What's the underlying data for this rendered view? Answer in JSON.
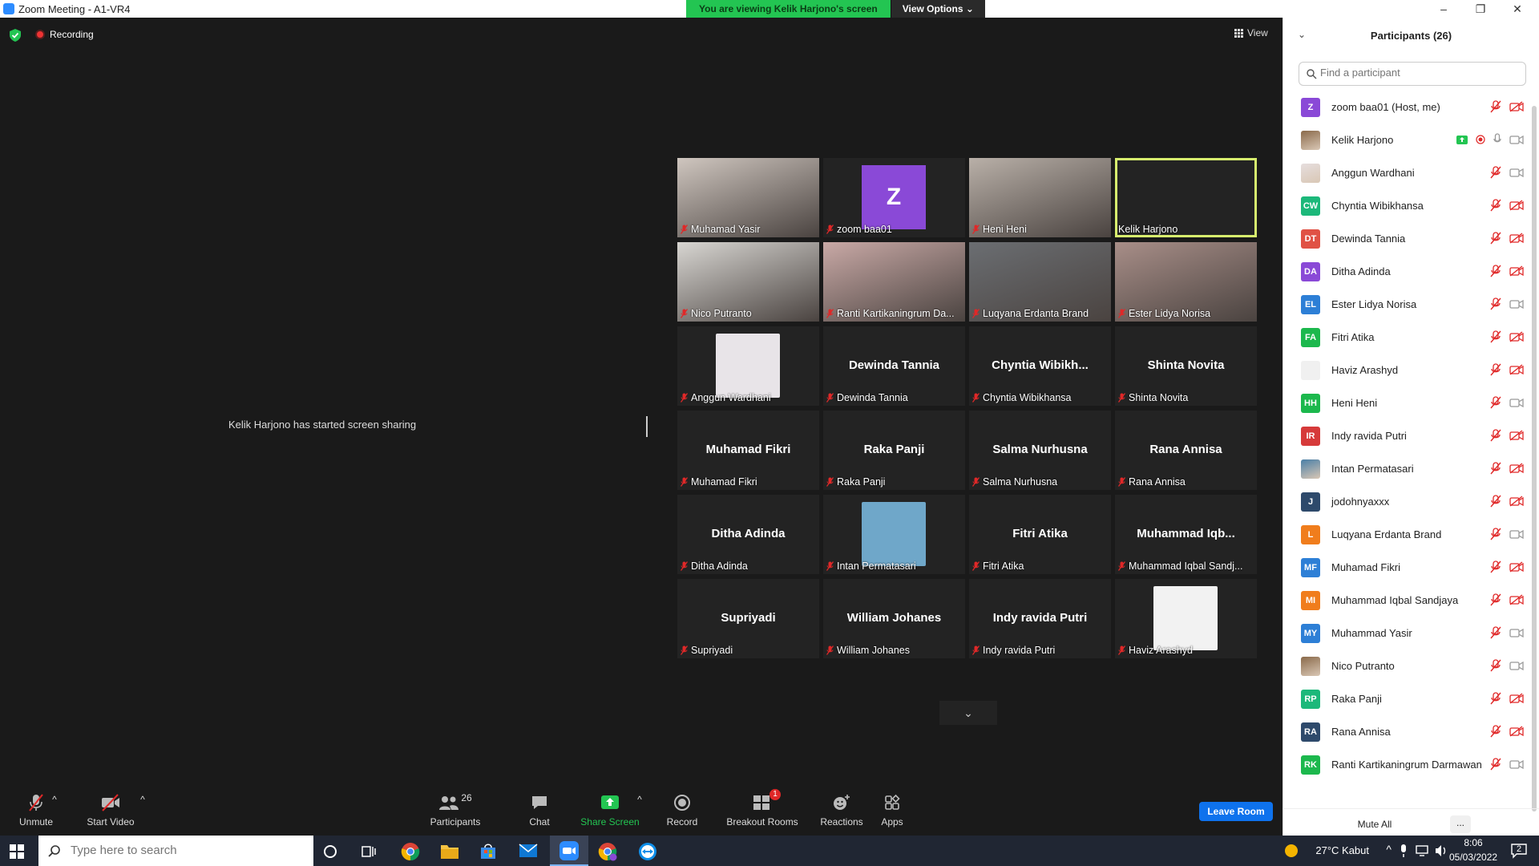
{
  "window": {
    "title": "Zoom Meeting - A1-VR4"
  },
  "share_banner": {
    "text": "You are viewing Kelik Harjono's screen",
    "view_options": "View Options"
  },
  "status": {
    "recording": "Recording",
    "view": "View"
  },
  "share_message": "Kelik Harjono has started screen sharing",
  "colors": {
    "accent": "#0e72ed",
    "banner_green": "#23c552",
    "active_border": "#d7ef6e",
    "muted_red": "#e02828"
  },
  "tiles": [
    {
      "label": "Muhamad Yasir",
      "type": "video",
      "video_color": "#cfc6bf"
    },
    {
      "label": "zoom baa01",
      "type": "avatar",
      "initial": "Z",
      "color": "#8a49d7"
    },
    {
      "label": "Heni Heni",
      "type": "video",
      "video_color": "#b9b0a8"
    },
    {
      "label": "Kelik Harjono",
      "type": "blank",
      "active": true,
      "unmuted": true
    },
    {
      "label": "Nico Putranto",
      "type": "video",
      "video_color": "#d8d6d2"
    },
    {
      "label": "Ranti Kartikaningrum Da...",
      "type": "video",
      "video_color": "#c9a9a6"
    },
    {
      "label": "Luqyana Erdanta Brand",
      "type": "video",
      "video_color": "#6b6e72"
    },
    {
      "label": "Ester Lidya Norisa",
      "type": "video",
      "video_color": "#a88e88"
    },
    {
      "label": "Anggun Wardhani",
      "type": "photo",
      "photo_color": "#e8e4e8"
    },
    {
      "label": "Dewinda Tannia",
      "type": "name",
      "name": "Dewinda Tannia"
    },
    {
      "label": "Chyntia Wibikhansa",
      "type": "name",
      "name": "Chyntia  Wibikh..."
    },
    {
      "label": "Shinta Novita",
      "type": "name",
      "name": "Shinta Novita"
    },
    {
      "label": "Muhamad Fikri",
      "type": "name",
      "name": "Muhamad Fikri"
    },
    {
      "label": "Raka Panji",
      "type": "name",
      "name": "Raka Panji"
    },
    {
      "label": "Salma Nurhusna",
      "type": "name",
      "name": "Salma Nurhusna"
    },
    {
      "label": "Rana Annisa",
      "type": "name",
      "name": "Rana Annisa"
    },
    {
      "label": "Ditha Adinda",
      "type": "name",
      "name": "Ditha Adinda"
    },
    {
      "label": "Intan Permatasari",
      "type": "photo",
      "photo_color": "#6fa7c9"
    },
    {
      "label": "Fitri Atika",
      "type": "name",
      "name": "Fitri Atika"
    },
    {
      "label": "Muhammad Iqbal Sandj...",
      "type": "name",
      "name": "Muhammad  Iqb..."
    },
    {
      "label": "Supriyadi",
      "type": "name",
      "name": "Supriyadi"
    },
    {
      "label": "William Johanes",
      "type": "name",
      "name": "William Johanes"
    },
    {
      "label": "Indy ravida Putri",
      "type": "name",
      "name": "Indy ravida Putri"
    },
    {
      "label": "Haviz Arashyd",
      "type": "photo",
      "photo_color": "#f2f2f2"
    }
  ],
  "toolbar": {
    "unmute": "Unmute",
    "start_video": "Start Video",
    "participants": "Participants",
    "participants_count": "26",
    "chat": "Chat",
    "share_screen": "Share Screen",
    "record": "Record",
    "breakout_rooms": "Breakout Rooms",
    "breakout_badge": "1",
    "reactions": "Reactions",
    "apps": "Apps",
    "leave_room": "Leave Room"
  },
  "panel": {
    "title": "Participants (26)",
    "search_placeholder": "Find a participant",
    "mute_all": "Mute All",
    "more": "...",
    "participants": [
      {
        "name": "zoom baa01 (Host, me)",
        "initials": "Z",
        "color": "#8a49d7",
        "video_off": true
      },
      {
        "name": "Kelik Harjono",
        "initials": "",
        "color": "#8a6a4a",
        "photo": true,
        "sharing": true
      },
      {
        "name": "Anggun Wardhani",
        "initials": "",
        "color": "#e6dede",
        "photo": true,
        "video_off": false
      },
      {
        "name": "Chyntia Wibikhansa",
        "initials": "CW",
        "color": "#1cb87a",
        "video_off": true
      },
      {
        "name": "Dewinda Tannia",
        "initials": "DT",
        "color": "#e05245",
        "video_off": true
      },
      {
        "name": "Ditha Adinda",
        "initials": "DA",
        "color": "#8a49d7",
        "video_off": true
      },
      {
        "name": "Ester Lidya Norisa",
        "initials": "EL",
        "color": "#2d7fd6",
        "video_off": false
      },
      {
        "name": "Fitri Atika",
        "initials": "FA",
        "color": "#1cb84d",
        "video_off": true
      },
      {
        "name": "Haviz Arashyd",
        "initials": "",
        "color": "#f0f0f0",
        "video_off": true
      },
      {
        "name": "Heni Heni",
        "initials": "HH",
        "color": "#1cb84d",
        "video_off": false
      },
      {
        "name": "Indy ravida Putri",
        "initials": "IR",
        "color": "#d63a3a",
        "video_off": true
      },
      {
        "name": "Intan Permatasari",
        "initials": "",
        "color": "#4a7fa6",
        "photo": true,
        "video_off": true
      },
      {
        "name": "jodohnyaxxx",
        "initials": "J",
        "color": "#2e4a6b",
        "video_off": true
      },
      {
        "name": "Luqyana Erdanta Brand",
        "initials": "L",
        "color": "#f07d1c",
        "video_off": false
      },
      {
        "name": "Muhamad Fikri",
        "initials": "MF",
        "color": "#2d7fd6",
        "video_off": true
      },
      {
        "name": "Muhammad Iqbal Sandjaya",
        "initials": "MI",
        "color": "#f07d1c",
        "video_off": true
      },
      {
        "name": "Muhammad Yasir",
        "initials": "MY",
        "color": "#2d7fd6",
        "video_off": false
      },
      {
        "name": "Nico Putranto",
        "initials": "",
        "color": "#8a6a4a",
        "photo": true,
        "video_off": false
      },
      {
        "name": "Raka Panji",
        "initials": "RP",
        "color": "#1cb87a",
        "video_off": true
      },
      {
        "name": "Rana Annisa",
        "initials": "RA",
        "color": "#2e4a6b",
        "video_off": true
      },
      {
        "name": "Ranti Kartikaningrum Darmawan",
        "initials": "RK",
        "color": "#1cb84d",
        "video_off": false
      }
    ]
  },
  "taskbar": {
    "search_placeholder": "Type here to search",
    "weather": "27°C  Kabut",
    "time": "8:06",
    "date": "05/03/2022",
    "notifications": "2"
  }
}
